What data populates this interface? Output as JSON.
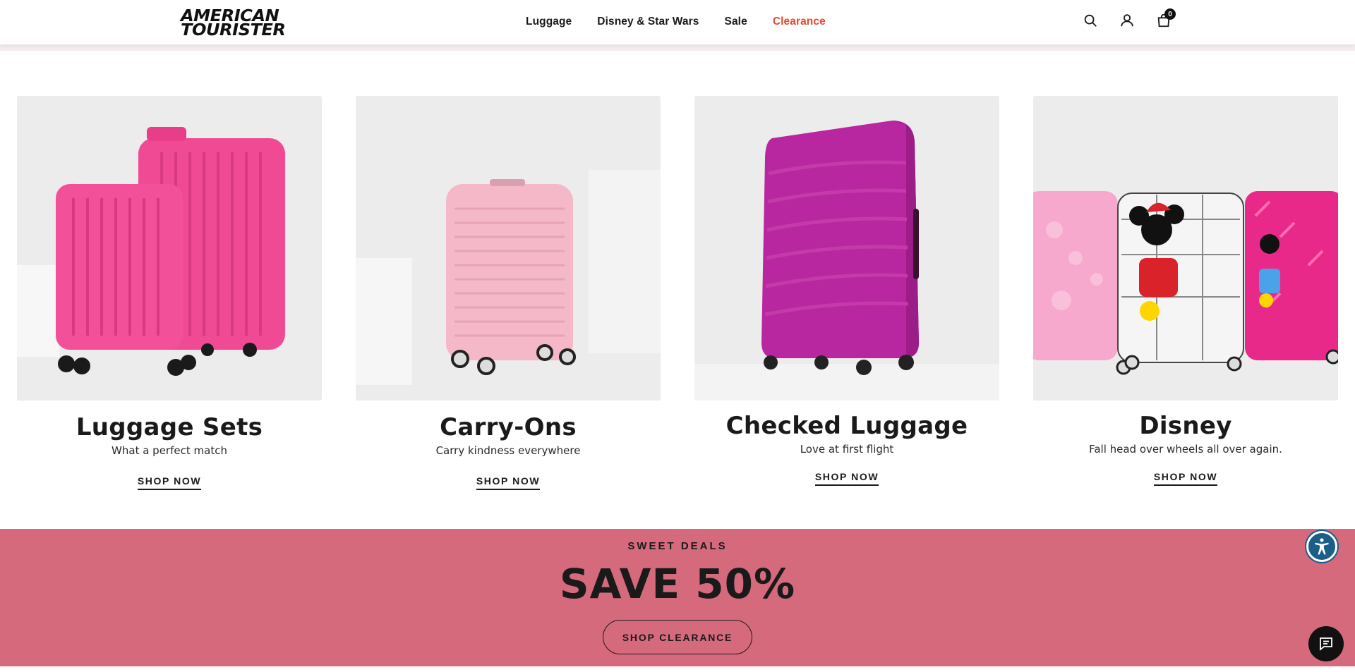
{
  "brand": {
    "line1": "AMERICAN",
    "line2": "TOURISTER"
  },
  "nav": {
    "items": [
      {
        "label": "Luggage"
      },
      {
        "label": "Disney & Star Wars"
      },
      {
        "label": "Sale"
      },
      {
        "label": "Clearance"
      }
    ]
  },
  "header_icons": {
    "search": "search-icon",
    "account": "user-icon",
    "cart": "shopping-bag-icon",
    "cart_count": "0"
  },
  "cards": [
    {
      "title": "Luggage Sets",
      "subtitle": "What a perfect match",
      "cta": "SHOP NOW",
      "color": "#f0408c"
    },
    {
      "title": "Carry-Ons",
      "subtitle": "Carry kindness everywhere",
      "cta": "SHOP NOW",
      "color": "#f2b8c6"
    },
    {
      "title": "Checked Luggage",
      "subtitle": "Love at first flight",
      "cta": "SHOP NOW",
      "color": "#b5249e"
    },
    {
      "title": "Disney",
      "subtitle": "Fall head over wheels all over again.",
      "cta": "SHOP NOW",
      "color": "#f7a8cc"
    }
  ],
  "promo": {
    "eyebrow": "SWEET DEALS",
    "title": "SAVE 50%",
    "cta": "SHOP CLEARANCE",
    "background": "#d66a7d"
  },
  "widgets": {
    "accessibility": "accessibility-icon",
    "chat": "chat-icon"
  },
  "colors": {
    "clearance": "#e8472b",
    "text": "#1a1a1a"
  }
}
